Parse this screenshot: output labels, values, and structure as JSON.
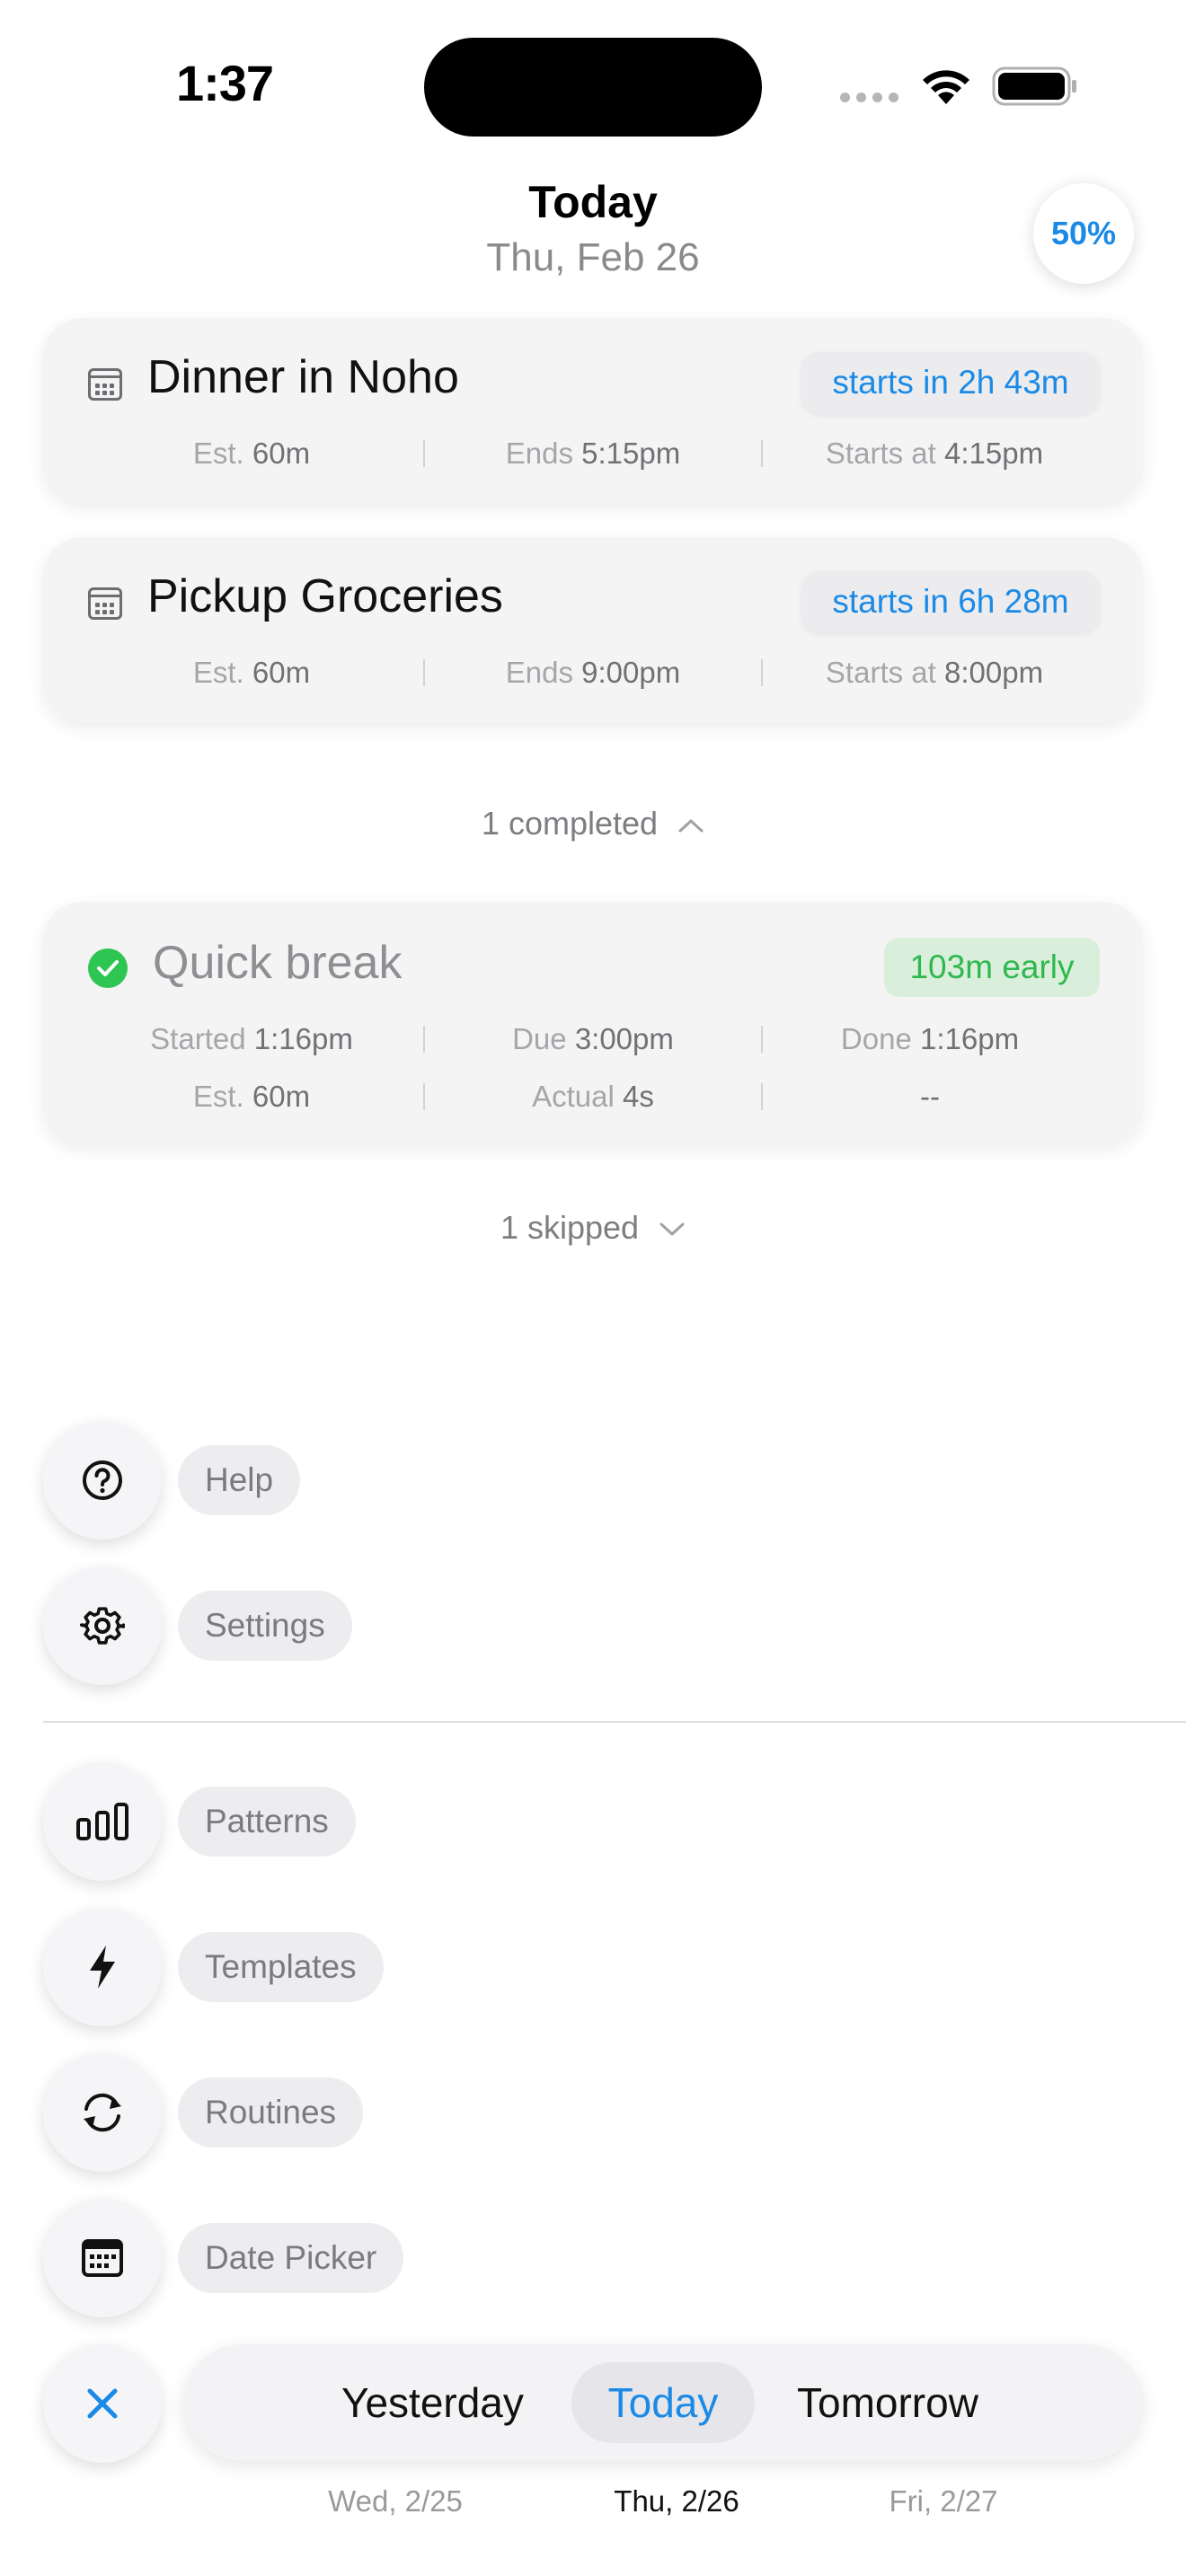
{
  "status_bar": {
    "time": "1:37"
  },
  "header": {
    "title": "Today",
    "date": "Thu, Feb 26",
    "progress": "50%"
  },
  "tasks": [
    {
      "title": "Dinner in Noho",
      "badge": "starts in 2h 43m",
      "est_label": "Est.",
      "est_value": "60m",
      "ends_label": "Ends",
      "ends_value": "5:15pm",
      "starts_label": "Starts at",
      "starts_value": "4:15pm"
    },
    {
      "title": "Pickup Groceries",
      "badge": "starts in 6h 28m",
      "est_label": "Est.",
      "est_value": "60m",
      "ends_label": "Ends",
      "ends_value": "9:00pm",
      "starts_label": "Starts at",
      "starts_value": "8:00pm"
    }
  ],
  "completed_toggle": "1 completed",
  "completed": {
    "title": "Quick break",
    "badge": "103m early",
    "started_label": "Started",
    "started_value": "1:16pm",
    "due_label": "Due",
    "due_value": "3:00pm",
    "done_label": "Done",
    "done_value": "1:16pm",
    "est_label": "Est.",
    "est_value": "60m",
    "actual_label": "Actual",
    "actual_value": "4s",
    "empty": "--"
  },
  "skipped_toggle": "1 skipped",
  "menu": {
    "help": "Help",
    "settings": "Settings",
    "patterns": "Patterns",
    "templates": "Templates",
    "routines": "Routines",
    "date_picker": "Date Picker"
  },
  "day_nav": {
    "yesterday": "Yesterday",
    "yesterday_date": "Wed, 2/25",
    "today": "Today",
    "today_date": "Thu, 2/26",
    "tomorrow": "Tomorrow",
    "tomorrow_date": "Fri, 2/27"
  },
  "colors": {
    "accent": "#1a8ae6",
    "success": "#2fc553"
  }
}
